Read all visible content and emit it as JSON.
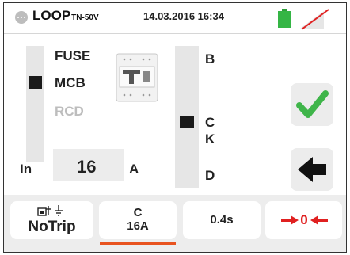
{
  "header": {
    "title": "LOOP",
    "subtitle": "TN-50V",
    "datetime": "14.03.2016 16:34",
    "icons": {
      "menu": "circle-dots-icon",
      "battery": "battery-full-icon",
      "signal": "signal-off-icon"
    },
    "colors": {
      "battery": "#35b545",
      "signal_slash": "#e02020"
    }
  },
  "device_types": [
    "FUSE",
    "MCB",
    "RCD"
  ],
  "selected_device": "MCB",
  "curves": [
    "B",
    "C",
    "K",
    "D"
  ],
  "selected_curve": "C",
  "rated_current": {
    "label": "In",
    "value": "16",
    "unit": "A"
  },
  "actions": {
    "confirm_icon": "check-icon",
    "back_icon": "back-arrow-icon"
  },
  "bottom_bar": {
    "trip_label": "NoTrip",
    "curve_line1": "C",
    "curve_line2": "16A",
    "time_label": "0.4s",
    "zero_label": "0"
  },
  "colors": {
    "accent": "#e8531f",
    "check": "#3fb54a",
    "zero_arrows": "#e02020",
    "disabled_text": "#bdbdbd"
  }
}
